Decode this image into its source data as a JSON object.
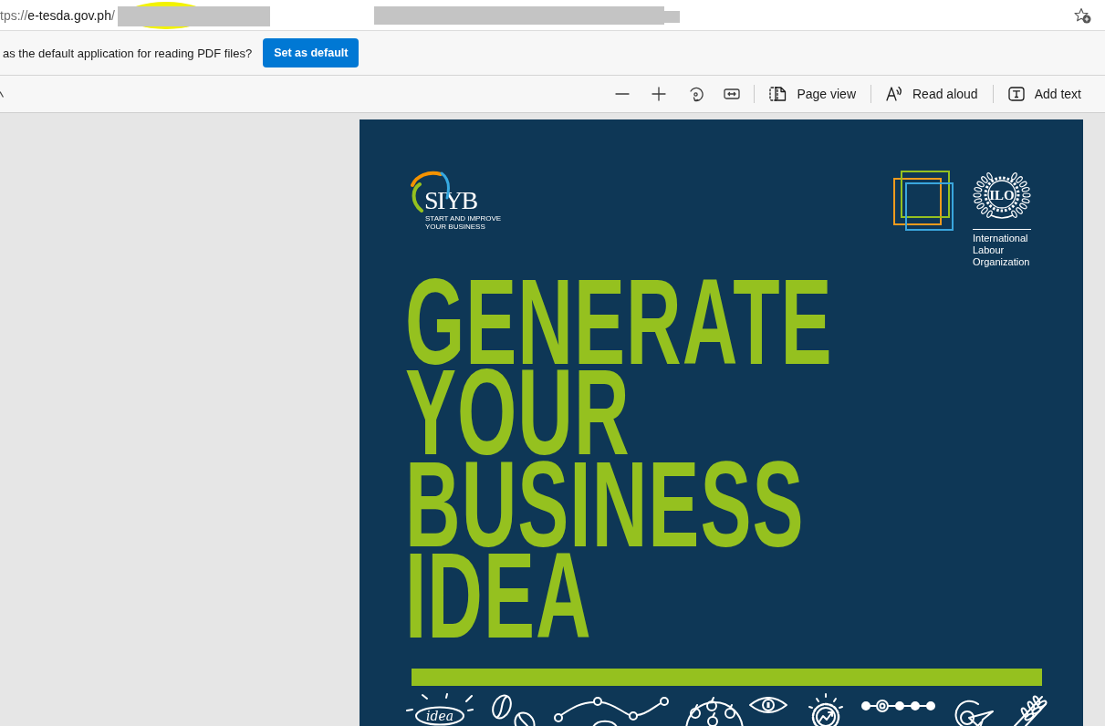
{
  "address_bar": {
    "url": {
      "scheme": "tps://",
      "host": "e-tesda.gov.ph",
      "path": "/"
    }
  },
  "info_bar": {
    "message": "as the default application for reading PDF files?",
    "button": "Set as default"
  },
  "pdf_toolbar": {
    "items": [
      {
        "kind": "zoom_out"
      },
      {
        "kind": "zoom_in"
      },
      {
        "kind": "rotate"
      },
      {
        "kind": "fit_width"
      },
      {
        "kind": "divider"
      },
      {
        "kind": "page_view",
        "label": "Page view"
      },
      {
        "kind": "divider"
      },
      {
        "kind": "read_aloud",
        "label": "Read aloud"
      },
      {
        "kind": "divider"
      },
      {
        "kind": "add_text",
        "label": "Add text"
      }
    ]
  },
  "document": {
    "siyb_logo": {
      "wordmark": "SIYB",
      "tagline": "START AND IMPROVE YOUR BUSINESS"
    },
    "ilo_logo": {
      "emblem_text": "ILO",
      "name": "International Labour Organization"
    },
    "title": "GENERATE YOUR BUSINESS IDEA",
    "doodles": [
      {
        "kind": "idea",
        "label": "idea"
      },
      {
        "kind": "coffee_beans"
      },
      {
        "kind": "route"
      },
      {
        "kind": "fruit"
      },
      {
        "kind": "eye"
      },
      {
        "kind": "growth"
      },
      {
        "kind": "timeline"
      },
      {
        "kind": "target"
      },
      {
        "kind": "wheat"
      }
    ]
  }
}
